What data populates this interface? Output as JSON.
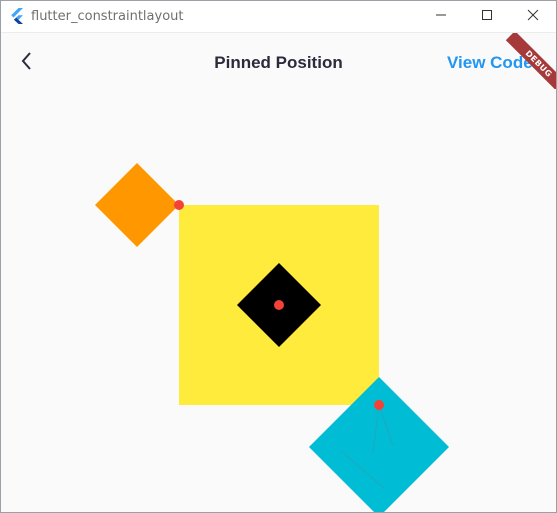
{
  "window": {
    "title": "flutter_constraintlayout"
  },
  "appbar": {
    "title": "Pinned Position",
    "view_code_label": "View Code",
    "debug_banner": "DEBUG"
  },
  "colors": {
    "yellow": "#ffeb3b",
    "orange": "#ff9800",
    "black": "#000000",
    "cyan": "#00bcd4",
    "pin": "#f44336",
    "accent": "#2196f3",
    "banner": "#a63a3a"
  },
  "icons": {
    "back": "chevron-left-icon",
    "minimize": "minimize-icon",
    "maximize": "maximize-icon",
    "close": "close-icon",
    "logo": "flutter-logo-icon"
  }
}
